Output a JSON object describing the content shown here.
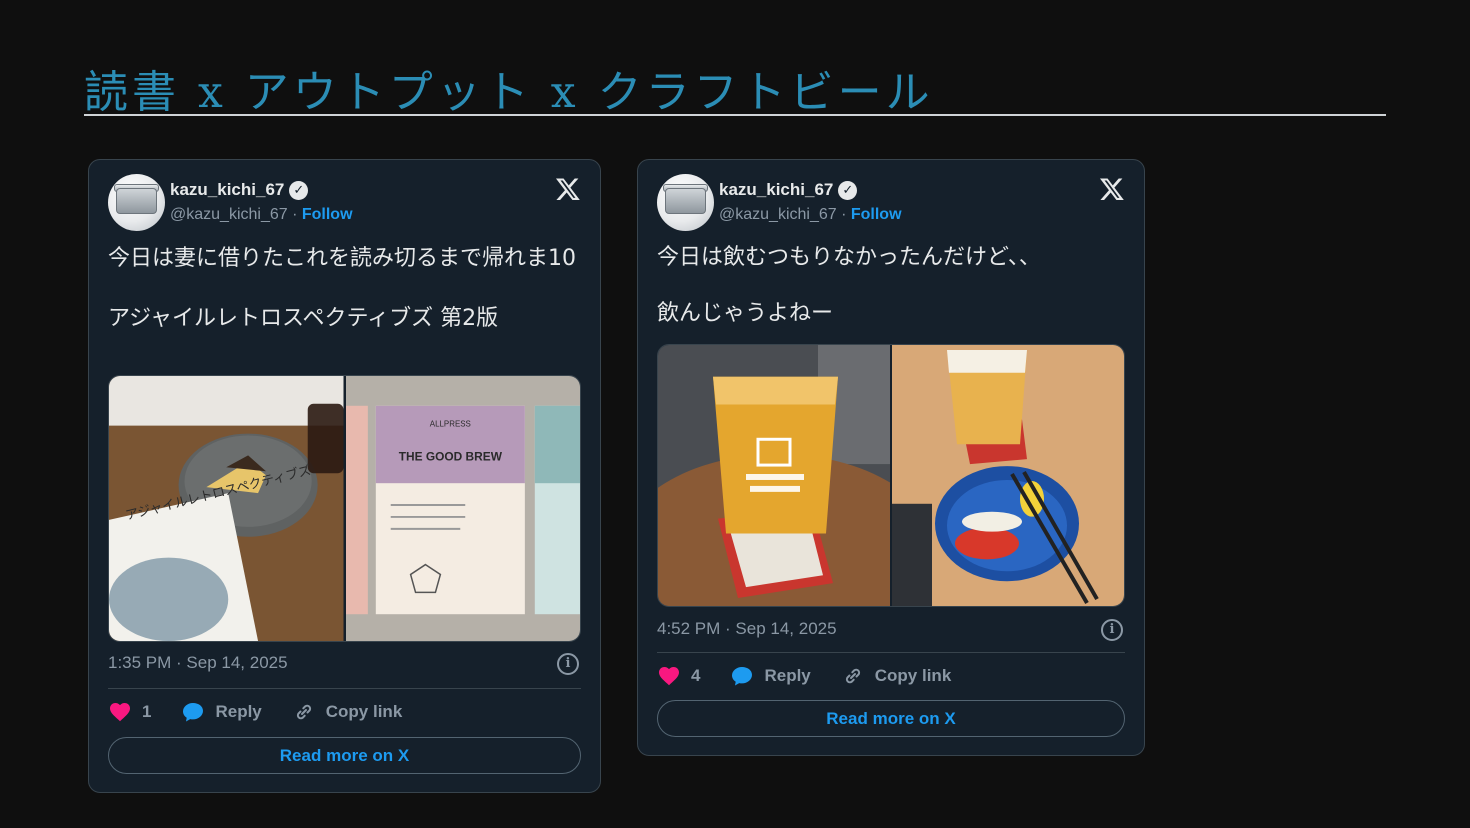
{
  "slide": {
    "title": "読書 x アウトプット x クラフトビール"
  },
  "tweets": [
    {
      "display_name": "kazu_kichi_67",
      "handle": "@kazu_kichi_67",
      "separator": " · ",
      "follow_label": "Follow",
      "text": "今日は妻に借りたこれを読み切るまで帰れま10\n\nアジャイルレトロスペクティブズ 第2版",
      "photo_texts": [
        "アジャイルレトロスペクティブズ",
        "THE GOOD BREW",
        "ALLPRESS"
      ],
      "timestamp": "1:35 PM · Sep 14, 2025",
      "likes": "1",
      "reply_label": "Reply",
      "copy_label": "Copy link",
      "read_more_label": "Read more on X"
    },
    {
      "display_name": "kazu_kichi_67",
      "handle": "@kazu_kichi_67",
      "separator": " · ",
      "follow_label": "Follow",
      "text": "今日は飲むつもりなかったんだけど、、\n\n飲んじゃうよねー",
      "timestamp": "4:52 PM · Sep 14, 2025",
      "likes": "4",
      "reply_label": "Reply",
      "copy_label": "Copy link",
      "read_more_label": "Read more on X"
    }
  ],
  "icons": [
    "verified-icon",
    "x-logo-icon",
    "heart-icon",
    "reply-bubble-icon",
    "link-icon",
    "info-icon"
  ],
  "colors": {
    "accent": "#1d9bf0",
    "heart": "#f91880",
    "card_bg": "#15202b",
    "title": "#2b8db5"
  }
}
